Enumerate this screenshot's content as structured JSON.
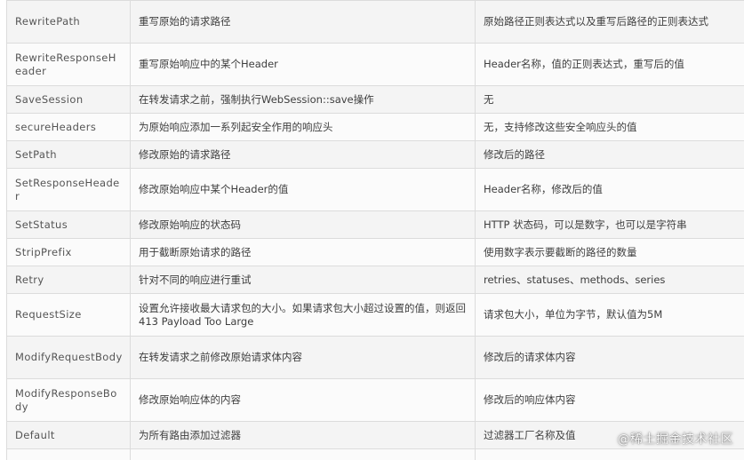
{
  "table": {
    "rows": [
      {
        "name": "RewritePath",
        "description": "重写原始的请求路径",
        "params": "原始路径正则表达式以及重写后路径的正则表达式"
      },
      {
        "name": "RewriteResponseHeader",
        "description": "重写原始响应中的某个Header",
        "params": "Header名称，值的正则表达式，重写后的值"
      },
      {
        "name": "SaveSession",
        "description": "在转发请求之前，强制执行WebSession::save操作",
        "params": "无"
      },
      {
        "name": "secureHeaders",
        "description": "为原始响应添加一系列起安全作用的响应头",
        "params": "无，支持修改这些安全响应头的值"
      },
      {
        "name": "SetPath",
        "description": "修改原始的请求路径",
        "params": "修改后的路径"
      },
      {
        "name": "SetResponseHeader",
        "description": "修改原始响应中某个Header的值",
        "params": "Header名称，修改后的值"
      },
      {
        "name": "SetStatus",
        "description": "修改原始响应的状态码",
        "params": "HTTP 状态码，可以是数字，也可以是字符串"
      },
      {
        "name": "StripPrefix",
        "description": "用于截断原始请求的路径",
        "params": "使用数字表示要截断的路径的数量"
      },
      {
        "name": "Retry",
        "description": "针对不同的响应进行重试",
        "params": "retries、statuses、methods、series"
      },
      {
        "name": "RequestSize",
        "description": "设置允许接收最大请求包的大小。如果请求包大小超过设置的值，则返回 413 Payload Too Large",
        "params": "请求包大小，单位为字节，默认值为5M"
      },
      {
        "name": "ModifyRequestBody",
        "description": "在转发请求之前修改原始请求体内容",
        "params": "修改后的请求体内容"
      },
      {
        "name": "ModifyResponseBody",
        "description": "修改原始响应体的内容",
        "params": "修改后的响应体内容"
      },
      {
        "name": "Default",
        "description": "为所有路由添加过滤器",
        "params": "过滤器工厂名称及值"
      },
      {
        "name": "",
        "description": "",
        "params": ""
      }
    ]
  },
  "watermark": "@稀土掘金技术社区"
}
